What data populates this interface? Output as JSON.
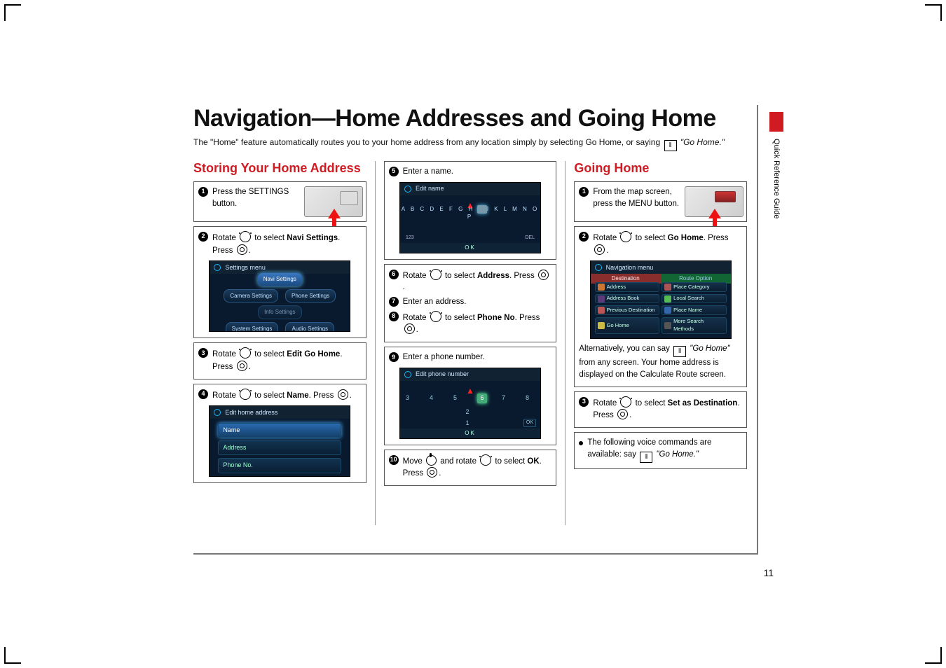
{
  "title": "Navigation—Home Addresses and Going Home",
  "intro_a": "The \"Home\" feature automatically routes you to your home address from any location simply by selecting Go Home, or saying ",
  "intro_b": " \"Go Home.\"",
  "side_label": "Quick Reference Guide",
  "page_number": "11",
  "col1": {
    "heading": "Storing Your Home Address",
    "s1": "Press the SETTINGS button.",
    "s2a": "Rotate ",
    "s2b": " to select ",
    "s2c": "Navi Settings",
    "s2d": ". Press ",
    "s2e": ".",
    "s3a": "Rotate ",
    "s3b": " to select ",
    "s3c": "Edit Go Home",
    "s3d": ". Press ",
    "s3e": ".",
    "s4a": "Rotate ",
    "s4b": " to select ",
    "s4c": "Name",
    "s4d": ". Press ",
    "s4e": ".",
    "shot_settings_title": "Settings menu",
    "shot_settings_items": {
      "navi": "Navi Settings",
      "camera": "Camera Settings",
      "phone": "Phone Settings",
      "info": "Info Settings",
      "system": "System Settings",
      "audio": "Audio Settings"
    },
    "shot_edit_title": "Edit home address",
    "shot_edit_items": {
      "name": "Name",
      "address": "Address",
      "phone": "Phone No."
    }
  },
  "col2": {
    "s5": "Enter a name.",
    "s6a": "Rotate ",
    "s6b": " to select ",
    "s6c": "Address",
    "s6d": ". Press ",
    "s6e": ".",
    "s7": "Enter an address.",
    "s8a": "Rotate ",
    "s8b": " to select ",
    "s8c": "Phone No",
    "s8d": ". Press ",
    "s8e": ".",
    "s9": "Enter a phone number.",
    "s10a": "Move ",
    "s10b": " and rotate ",
    "s10c": " to select ",
    "s10d": "OK",
    "s10e": ". Press ",
    "s10f": ".",
    "shot_name_title": "Edit name",
    "shot_phone_title": "Edit phone number",
    "shot_name_letters": "A B C D E F G H I J K L M N O P",
    "shot_ok": "OK",
    "shot_123": "123",
    "shot_del": "DEL"
  },
  "col3": {
    "heading": "Going Home",
    "s1": "From the map screen, press the MENU button.",
    "s2a": "Rotate ",
    "s2b": " to select ",
    "s2c": "Go Home",
    "s2d": ". Press ",
    "s2e": ".",
    "alt_a": "Alternatively, you can say ",
    "alt_b": " \"Go Home\"",
    "alt_c": " from any screen. Your home address is displayed on the Calculate Route screen.",
    "s3a": "Rotate ",
    "s3b": " to select ",
    "s3c": "Set as Destination",
    "s3d": ". Press ",
    "s3e": ".",
    "voice_a": "The following voice commands are available: say ",
    "voice_b": " \"Go Home.\"",
    "shot_nav_title": "Navigation menu",
    "shot_nav_tabs": {
      "dest": "Destination",
      "route": "Route Option"
    },
    "shot_nav_items": {
      "addr": "Address",
      "place": "Place Category",
      "ab": "Address Book",
      "local": "Local Search",
      "prev": "Previous Destination",
      "pname": "Place Name",
      "gohome": "Go Home",
      "more": "More Search Methods"
    }
  }
}
